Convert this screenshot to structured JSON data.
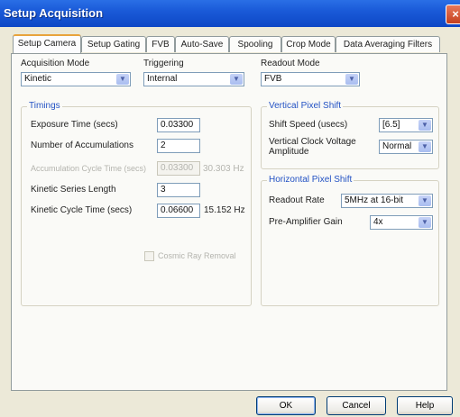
{
  "window": {
    "title": "Setup Acquisition",
    "close_glyph": "×"
  },
  "tabs": [
    {
      "label": "Setup Camera",
      "active": true
    },
    {
      "label": "Setup Gating"
    },
    {
      "label": "FVB"
    },
    {
      "label": "Auto-Save"
    },
    {
      "label": "Spooling"
    },
    {
      "label": "Crop Mode"
    },
    {
      "label": "Data Averaging Filters"
    }
  ],
  "acquisition_mode": {
    "label": "Acquisition Mode",
    "value": "Kinetic"
  },
  "triggering": {
    "label": "Triggering",
    "value": "Internal"
  },
  "readout_mode": {
    "label": "Readout Mode",
    "value": "FVB"
  },
  "timings": {
    "title": "Timings",
    "exposure_label": "Exposure Time (secs)",
    "exposure_value": "0.03300",
    "accumulations_label": "Number of Accumulations",
    "accumulations_value": "2",
    "acc_cycle_label": "Accumulation Cycle Time (secs)",
    "acc_cycle_value": "0.03300",
    "acc_cycle_freq": "30.303 Hz",
    "kinetic_length_label": "Kinetic Series Length",
    "kinetic_length_value": "3",
    "kinetic_cycle_label": "Kinetic Cycle Time (secs)",
    "kinetic_cycle_value": "0.06600",
    "kinetic_cycle_freq": "15.152 Hz",
    "cosmic_label": "Cosmic Ray Removal"
  },
  "vertical_shift": {
    "title": "Vertical Pixel Shift",
    "speed_label": "Shift Speed (usecs)",
    "speed_value": "[6.5]",
    "clock_label_1": "Vertical Clock Voltage",
    "clock_label_2": "Amplitude",
    "clock_value": "Normal"
  },
  "horizontal_shift": {
    "title": "Horizontal Pixel Shift",
    "readout_label": "Readout Rate",
    "readout_value": "5MHz at 16-bit",
    "preamp_label": "Pre-Amplifier Gain",
    "preamp_value": "4x"
  },
  "buttons": {
    "ok": "OK",
    "cancel": "Cancel",
    "help": "Help"
  },
  "icons": {
    "dropdown": "chevron-down-icon",
    "close": "close-icon"
  },
  "colors": {
    "titlebar": "#0d47c6",
    "group_title": "#2352c4",
    "active_tab_accent": "#e8a33c"
  }
}
